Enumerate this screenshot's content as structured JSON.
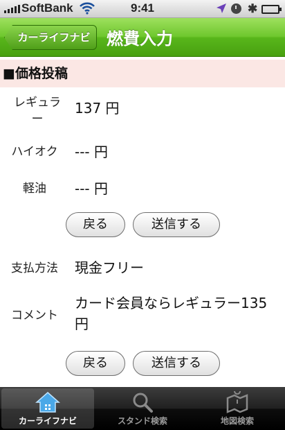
{
  "status_bar": {
    "carrier": "SoftBank",
    "time": "9:41"
  },
  "nav": {
    "back_label": "カーライフナビ",
    "title": "燃費入力"
  },
  "section": {
    "title": "■価格投稿"
  },
  "prices": [
    {
      "label_line1": "レギュラ",
      "label_line2": "ー",
      "value": "137 円"
    },
    {
      "label": "ハイオク",
      "value": "--- 円"
    },
    {
      "label": "軽油",
      "value": "--- 円"
    }
  ],
  "buttons": {
    "back": "戻る",
    "send": "送信する"
  },
  "payment": {
    "label": "支払方法",
    "value": "現金フリー"
  },
  "comment": {
    "label": "コメント",
    "line1": "カード会員ならレギュラー135",
    "line2": "円"
  },
  "tabs": [
    {
      "label": "カーライフナビ",
      "icon": "home-icon"
    },
    {
      "label": "スタンド検索",
      "icon": "search-icon"
    },
    {
      "label": "地図検索",
      "icon": "map-icon"
    }
  ],
  "colors": {
    "nav_green": "#58b61b",
    "section_bg": "#fbe7e4",
    "tab_bg": "#000000"
  }
}
